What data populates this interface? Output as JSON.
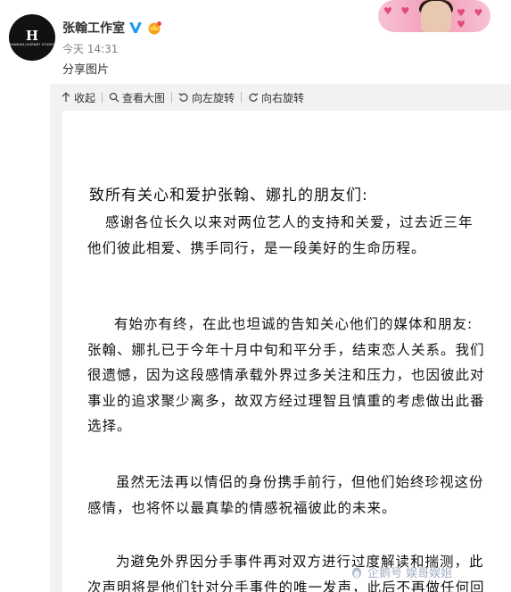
{
  "post": {
    "author": "张翰工作室",
    "avatar_text": "H",
    "avatar_subtext": "HANHAN JOURNEY STUDIO",
    "time": "今天 14:31",
    "description": "分享图片"
  },
  "toolbar": {
    "collapse": "收起",
    "view_large": "查看大图",
    "rotate_left": "向左旋转",
    "rotate_right": "向右旋转"
  },
  "letter": {
    "title": "致所有关心和爱护张翰、娜扎的朋友们:",
    "paragraphs": [
      [
        "感谢各位长久以来对两位艺人的支持和关爱，过去近三年",
        "他们彼此相爱、携手同行，是一段美好的生命历程。"
      ],
      [
        "有始亦有终，在此也坦诚的告知关心他们的媒体和朋友:",
        "张翰、娜扎已于今年十月中旬和平分手，结束恋人关系。我们",
        "很遗憾，因为这段感情承载外界过多关注和压力，也因彼此对",
        "事业的追求聚少离多，故双方经过理智且慎重的考虑做出此番",
        "选择。"
      ],
      [
        "虽然无法再以情侣的身份携手前行，但他们始终珍视这份",
        "感情，也将怀以最真挚的情感祝福彼此的未来。"
      ],
      [
        "为避免外界因分手事件再对双方进行过度解读和揣测，此",
        "次声明将是他们针对分手事件的唯一发声，此后不再做任何回"
      ]
    ]
  },
  "watermark": "企鹅号 娱哥娱姐",
  "colors": {
    "toolbar_bg": "#f2f2f5",
    "verified_blue": "#1d9bf0",
    "vip_orange": "#f7a01e"
  }
}
